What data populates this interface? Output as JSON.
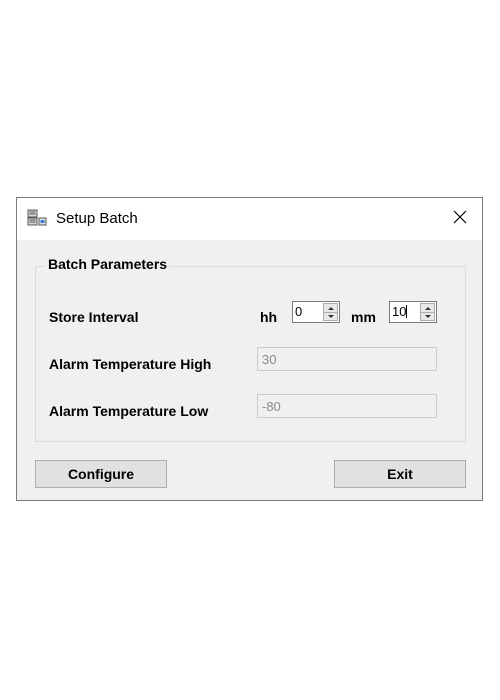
{
  "window": {
    "title": "Setup Batch",
    "icon": "batch-setup-icon",
    "close_icon": "close-icon"
  },
  "group": {
    "label": "Batch Parameters"
  },
  "store_interval": {
    "label": "Store Interval",
    "hh_label": "hh",
    "hh_value": "0",
    "mm_label": "mm",
    "mm_value": "10"
  },
  "alarm_high": {
    "label": "Alarm Temperature High",
    "value": "30"
  },
  "alarm_low": {
    "label": "Alarm Temperature Low",
    "value": "-80"
  },
  "buttons": {
    "configure": "Configure",
    "exit": "Exit"
  }
}
